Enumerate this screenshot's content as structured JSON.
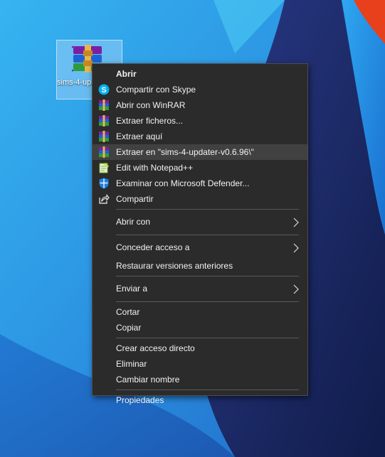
{
  "desktop": {
    "icon": {
      "name": "sims-4-updater-v0.6.96",
      "icon": "winrar-archive-icon"
    }
  },
  "menu": {
    "items": [
      {
        "label": "Abrir"
      },
      {
        "label": "Compartir con Skype",
        "icon": "skype-icon"
      },
      {
        "label": "Abrir con WinRAR",
        "icon": "winrar-icon"
      },
      {
        "label": "Extraer ficheros...",
        "icon": "winrar-icon"
      },
      {
        "label": "Extraer aquí",
        "icon": "winrar-icon"
      },
      {
        "label": "Extraer en \"sims-4-updater-v0.6.96\\\"",
        "icon": "winrar-icon"
      },
      {
        "label": "Edit with Notepad++",
        "icon": "notepad-plus-plus-icon"
      },
      {
        "label": "Examinar con Microsoft Defender...",
        "icon": "defender-shield-icon"
      },
      {
        "label": "Compartir",
        "icon": "share-icon"
      },
      {
        "label": "Abrir con"
      },
      {
        "label": "Conceder acceso a"
      },
      {
        "label": "Restaurar versiones anteriores"
      },
      {
        "label": "Enviar a"
      },
      {
        "label": "Cortar"
      },
      {
        "label": "Copiar"
      },
      {
        "label": "Crear acceso directo"
      },
      {
        "label": "Eliminar"
      },
      {
        "label": "Cambiar nombre"
      },
      {
        "label": "Propiedades"
      }
    ],
    "highlighted_item": "Extraer en \"sims-4-updater-v0.6.96\\\""
  },
  "colors": {
    "menu_background": "#2b2b2b",
    "menu_text": "#f2f2f2",
    "highlight": "#414141",
    "separator": "#5a5a5a",
    "desktop_blue": "#2b8fd6",
    "desktop_navy": "#16265e",
    "desktop_red": "#e8401c"
  }
}
